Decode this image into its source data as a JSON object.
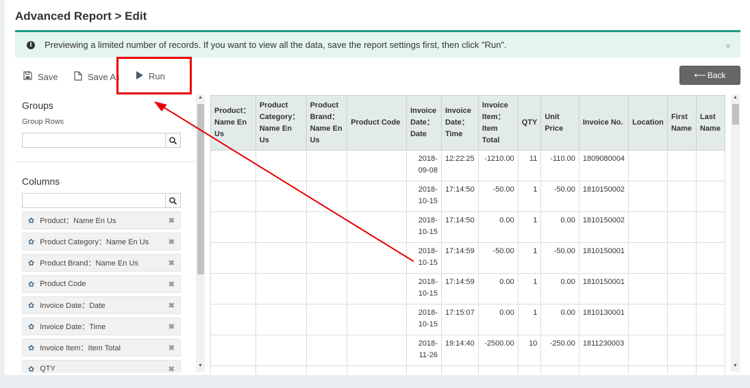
{
  "page": {
    "title": "Advanced Report > Edit"
  },
  "alert": {
    "icon": "info-icon",
    "message": "Previewing a limited number of records. If you want to view all the data, save the report settings first, then click \"Run\".",
    "close": "×"
  },
  "toolbar": {
    "save_label": "Save",
    "save_as_label": "Save As",
    "run_label": "Run",
    "back_label": "Back"
  },
  "groups": {
    "title": "Groups",
    "subtitle": "Group Rows",
    "search_value": ""
  },
  "columns": {
    "title": "Columns",
    "search_value": "",
    "items": [
      {
        "label": "Product：Name En Us"
      },
      {
        "label": "Product Category：Name En Us"
      },
      {
        "label": "Product Brand：Name En Us"
      },
      {
        "label": "Product Code"
      },
      {
        "label": "Invoice Date：Date"
      },
      {
        "label": "Invoice Date：Time"
      },
      {
        "label": "Invoice Item：Item Total"
      },
      {
        "label": "QTY"
      }
    ]
  },
  "table": {
    "headers": [
      "Product：Name En Us",
      "Product Category：Name En Us",
      "Product Brand：Name En Us",
      "Product Code",
      "Invoice Date：Date",
      "Invoice Date：Time",
      "Invoice Item：Item Total",
      "QTY",
      "Unit Price",
      "Invoice No.",
      "Location",
      "First Name",
      "Last Name"
    ],
    "rows": [
      {
        "date": "2018-09-08",
        "time": "12:22:25",
        "item_total": "-1210.00",
        "qty": "11",
        "unit_price": "-110.00",
        "invoice_no": "1809080004"
      },
      {
        "date": "2018-10-15",
        "time": "17:14:50",
        "item_total": "-50.00",
        "qty": "1",
        "unit_price": "-50.00",
        "invoice_no": "1810150002"
      },
      {
        "date": "2018-10-15",
        "time": "17:14:50",
        "item_total": "0.00",
        "qty": "1",
        "unit_price": "0.00",
        "invoice_no": "1810150002"
      },
      {
        "date": "2018-10-15",
        "time": "17:14:59",
        "item_total": "-50.00",
        "qty": "1",
        "unit_price": "-50.00",
        "invoice_no": "1810150001"
      },
      {
        "date": "2018-10-15",
        "time": "17:14:59",
        "item_total": "0.00",
        "qty": "1",
        "unit_price": "0.00",
        "invoice_no": "1810150001"
      },
      {
        "date": "2018-10-15",
        "time": "17:15:07",
        "item_total": "0.00",
        "qty": "1",
        "unit_price": "0.00",
        "invoice_no": "1810130001"
      },
      {
        "date": "2018-11-26",
        "time": "19:14:40",
        "item_total": "-2500.00",
        "qty": "10",
        "unit_price": "-250.00",
        "invoice_no": "1811230003"
      }
    ]
  },
  "colors": {
    "alert_border": "#1a9e84",
    "alert_bg": "#e4f4ef",
    "annotation": "#e80000",
    "header_bg": "#e2ebea"
  }
}
